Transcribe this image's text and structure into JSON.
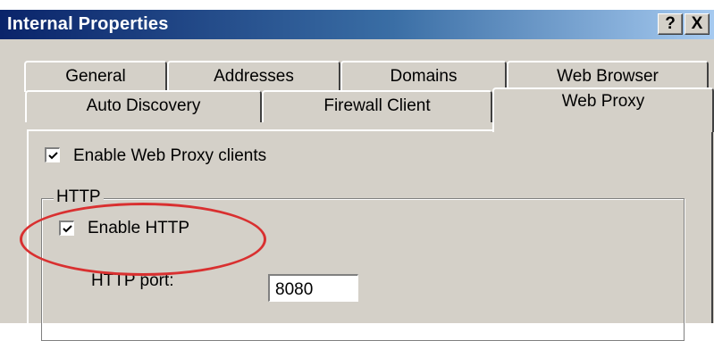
{
  "window": {
    "title": "Internal Properties",
    "help_button": "?",
    "close_button": "X"
  },
  "tabs": {
    "row_back": [
      "General",
      "Addresses",
      "Domains",
      "Web Browser"
    ],
    "row_front": [
      "Auto Discovery",
      "Firewall Client",
      "Web Proxy"
    ],
    "selected": "Web Proxy"
  },
  "web_proxy": {
    "enable_clients": {
      "label": "Enable Web Proxy clients",
      "checked": true
    },
    "http_group": {
      "title": "HTTP",
      "enable_http": {
        "label": "Enable HTTP",
        "checked": true
      },
      "port_label": "HTTP port:",
      "port_value": "8080"
    }
  },
  "colors": {
    "dialog_face": "#d4d0c8",
    "titlebar_start": "#0a246a",
    "titlebar_end": "#a6caf0",
    "annotation": "#d93030"
  }
}
